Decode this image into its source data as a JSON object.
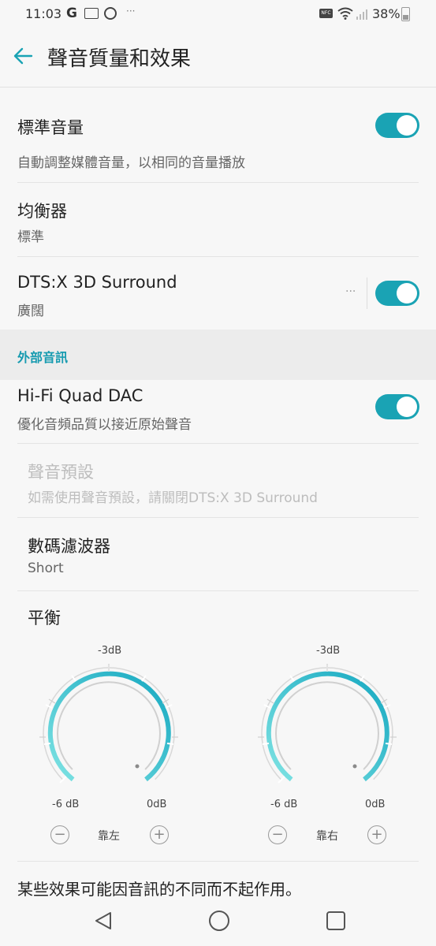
{
  "status": {
    "time": "11:03",
    "battery": "38%",
    "g": "G",
    "dots": "···",
    "nfc": "NFC"
  },
  "header": {
    "title": "聲音質量和效果"
  },
  "settings": {
    "standard_volume": {
      "title": "標準音量",
      "subtitle": "自動調整媒體音量，以相同的音量播放",
      "on": true
    },
    "equalizer": {
      "title": "均衡器",
      "subtitle": "標準"
    },
    "dts": {
      "title": "DTS:X 3D Surround",
      "subtitle": "廣闊",
      "more": "···",
      "on": true
    }
  },
  "external": {
    "section_label": "外部音訊",
    "hifi": {
      "title": "Hi-Fi Quad DAC",
      "subtitle": "優化音頻品質以接近原始聲音",
      "on": true
    },
    "sound_preset": {
      "title": "聲音預設",
      "subtitle": "如需使用聲音預設，請關閉DTS:X 3D Surround",
      "enabled": false
    },
    "digital_filter": {
      "title": "數碼濾波器",
      "subtitle": "Short"
    },
    "balance": {
      "title": "平衡",
      "left": {
        "top_label": "-3dB",
        "min_label": "-6 dB",
        "max_label": "0dB",
        "side_label": "靠左",
        "minus": "−",
        "plus": "+"
      },
      "right": {
        "top_label": "-3dB",
        "min_label": "-6 dB",
        "max_label": "0dB",
        "side_label": "靠右",
        "minus": "−",
        "plus": "+"
      }
    }
  },
  "footer_note": "某些效果可能因音訊的不同而不起作用。",
  "colors": {
    "accent": "#1aa3b4",
    "accent_light": "#7fe3e3",
    "section_bg": "#ececec"
  },
  "icons": {
    "back": "arrow-left-icon",
    "nav_back": "triangle-back-icon",
    "nav_home": "circle-home-icon",
    "nav_recent": "square-recent-icon"
  }
}
